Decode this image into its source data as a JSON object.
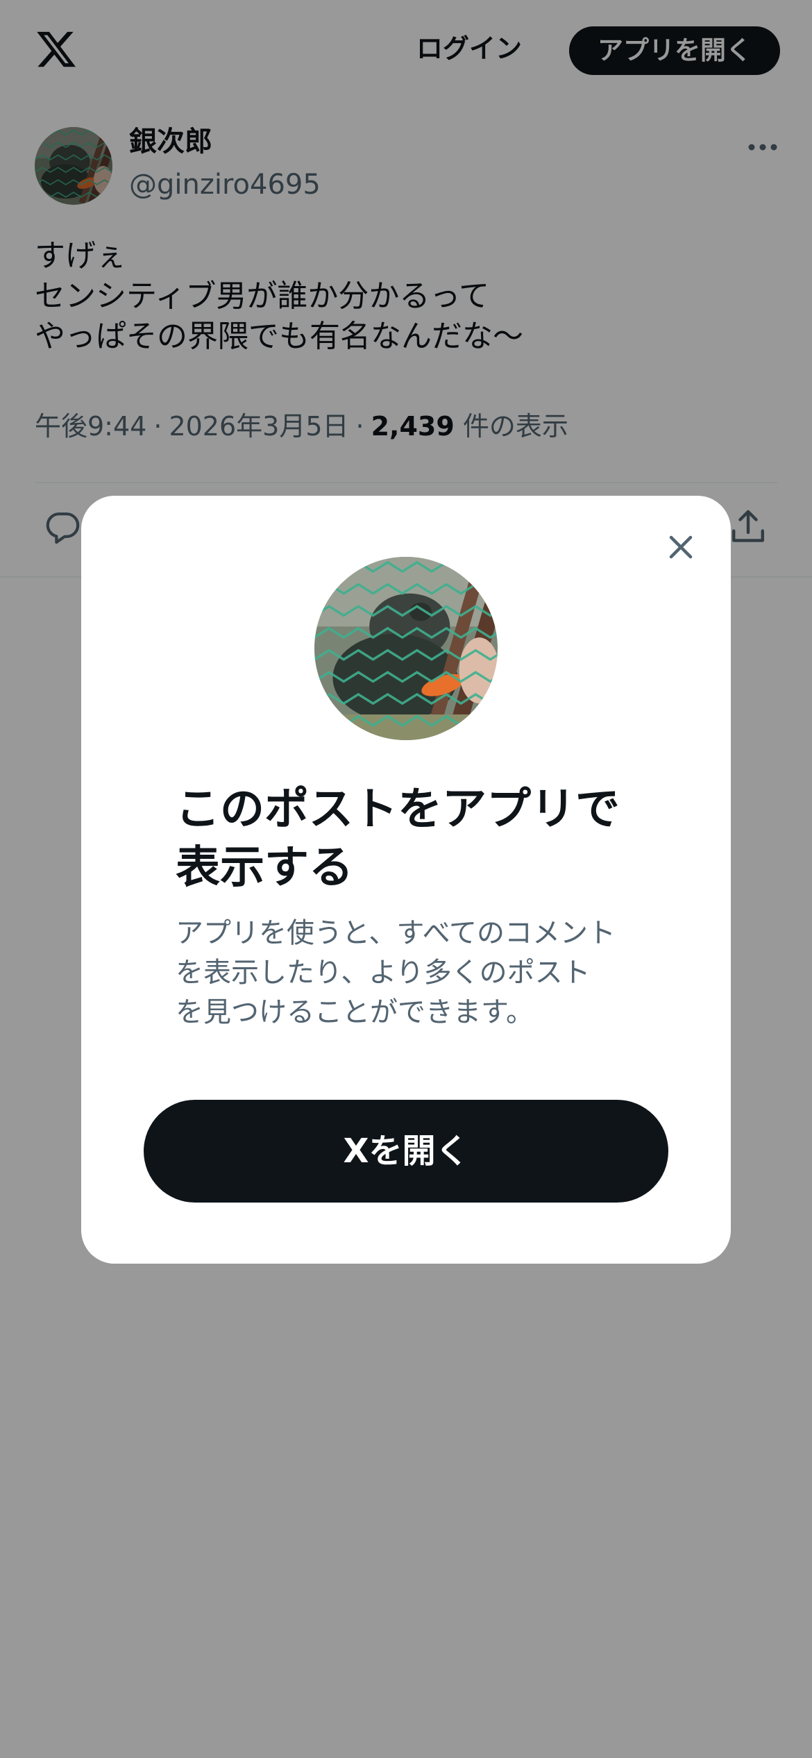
{
  "header": {
    "logo": "x-logo",
    "login_label": "ログイン",
    "open_app_label": "アプリを開く"
  },
  "tweet": {
    "display_name": "銀次郎",
    "handle": "@ginziro4695",
    "text_lines": [
      "すげぇ",
      "センシティブ男が誰か分かるって",
      "やっぱその界隈でも有名なんだな〜"
    ],
    "time": "午後9:44",
    "date": "2026年3月5日",
    "views_count": "2,439",
    "views_label": "件の表示",
    "separator": "·"
  },
  "modal": {
    "title_lines": [
      "このポストをアプリで",
      "表示する"
    ],
    "description_lines": [
      "アプリを使うと、すべてのコメント",
      "を表示したり、より多くのポスト",
      "を見つけることができます。"
    ],
    "open_button_label": "Xを開く"
  },
  "colors": {
    "text_primary": "#0f1419",
    "text_secondary": "#536471",
    "overlay": "rgba(0,0,0,0.4)",
    "button_dark": "#0f1419",
    "divider": "#eff3f4"
  },
  "icons": [
    "x-logo-icon",
    "more-icon",
    "reply-icon",
    "share-icon",
    "close-icon"
  ]
}
